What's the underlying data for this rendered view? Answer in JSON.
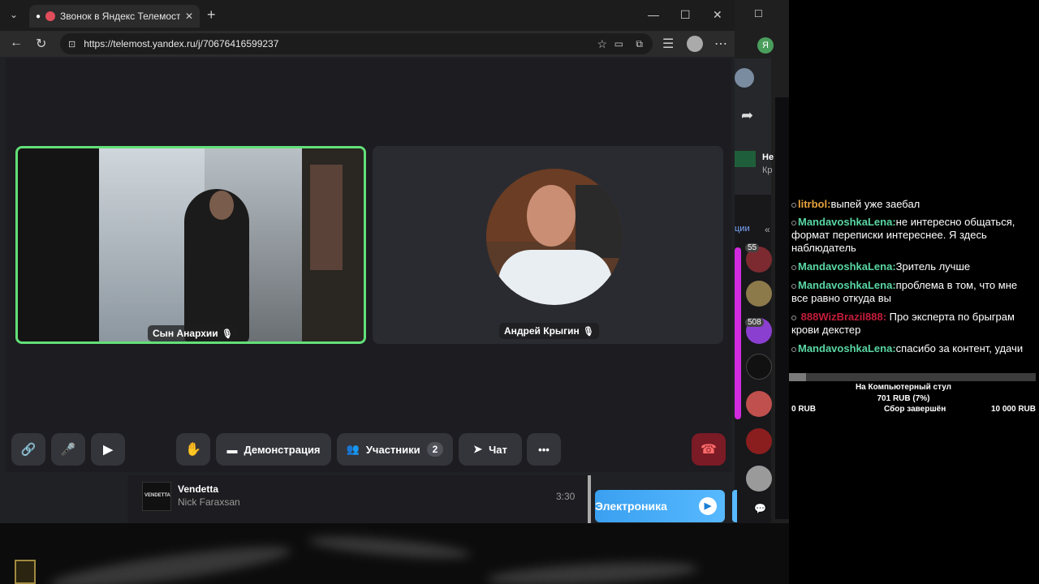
{
  "browser": {
    "tab_title": "Звонок в Яндекс Телемосте",
    "url": "https://telemost.yandex.ru/j/70676416599237",
    "profile_letter": "Я"
  },
  "meeting": {
    "participants": [
      {
        "name": "Сын Анархии"
      },
      {
        "name": "Андрей Крыгин"
      }
    ],
    "controls": {
      "demo_label": "Демонстрация",
      "participants_label": "Участники",
      "participants_count": "2",
      "chat_label": "Чат"
    }
  },
  "music": {
    "title": "Vendetta",
    "artist": "Nick Faraxsan",
    "duration": "3:30",
    "cover_text": "VENDETTA",
    "genre_button": "Электроника"
  },
  "bg_window": {
    "title_fragment": "Не",
    "sub_fragment": "Кр",
    "link_fragment": "ции",
    "badge_55": "55",
    "badge_508": "508"
  },
  "chat": {
    "messages": [
      {
        "user": "litrbol",
        "text": "выпей уже заебал"
      },
      {
        "user": "MandavoshkaLena",
        "text": "не интересно общаться, формат переписки интереснее. Я здесь наблюдатель"
      },
      {
        "user": "MandavoshkaLena",
        "text": "Зритель лучше"
      },
      {
        "user": "MandavoshkaLena",
        "text": "проблема в том, что мне все равно откуда вы"
      },
      {
        "user": "888WizBrazil888",
        "text": "Про эксперта по брыграм крови декстер"
      },
      {
        "user": "MandavoshkaLena",
        "text": "спасибо за контент, удачи"
      }
    ]
  },
  "donation": {
    "goal_title": "На Компьютерный стул",
    "raised": "701 RUB (7%)",
    "min": "0 RUB",
    "status": "Сбор завершён",
    "max": "10 000 RUB",
    "progress": 0.07
  }
}
